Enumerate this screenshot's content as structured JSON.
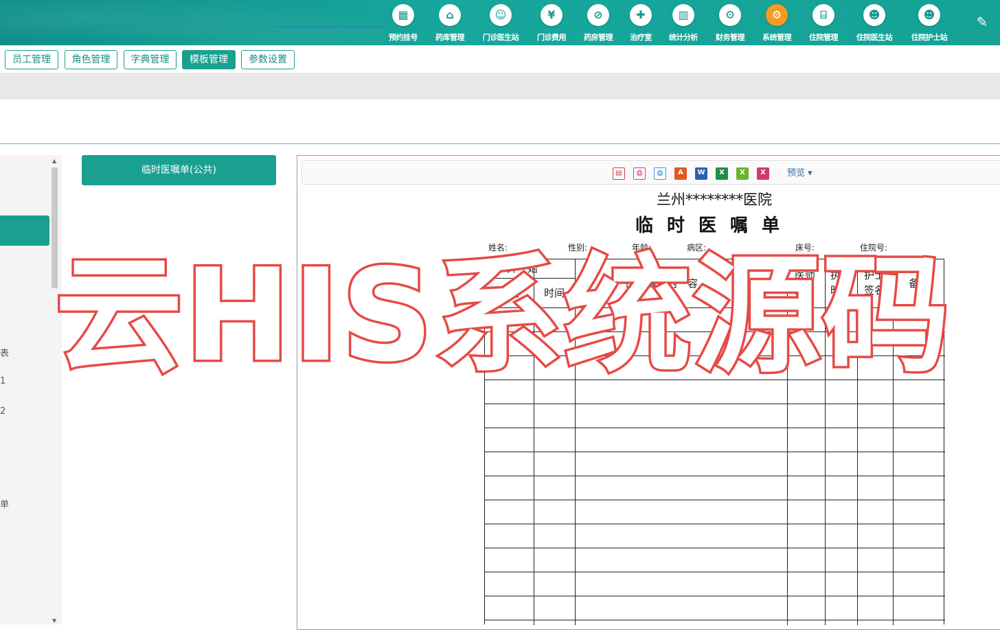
{
  "nav": {
    "items": [
      {
        "label": "预约挂号",
        "icon": "registration-icon"
      },
      {
        "label": "药库管理",
        "icon": "pharmacy-store-icon"
      },
      {
        "label": "门诊医生站",
        "icon": "doctor-icon"
      },
      {
        "label": "门诊费用",
        "icon": "yen-icon"
      },
      {
        "label": "药房管理",
        "icon": "pill-icon"
      },
      {
        "label": "治疗室",
        "icon": "treatment-icon"
      },
      {
        "label": "统计分析",
        "icon": "chart-icon"
      },
      {
        "label": "财务管理",
        "icon": "finance-gear-icon"
      },
      {
        "label": "系统管理",
        "icon": "system-gear-icon"
      },
      {
        "label": "住院管理",
        "icon": "bed-icon"
      },
      {
        "label": "住院医生站",
        "icon": "inpatient-doctor-icon"
      },
      {
        "label": "住院护士站",
        "icon": "nurse-icon"
      }
    ],
    "active_label": "系统管理",
    "edit_icon": "pencil-icon"
  },
  "subtabs": [
    {
      "label": "员工管理"
    },
    {
      "label": "角色管理"
    },
    {
      "label": "字典管理"
    },
    {
      "label": "模板管理"
    },
    {
      "label": "参数设置"
    }
  ],
  "active_subtab": "模板管理",
  "tree_fragments": [
    "表",
    "1",
    "2",
    "单"
  ],
  "template_button": "临时医嘱单(公共)",
  "toolbar": {
    "icons": [
      "page-setup-icon",
      "print-icon",
      "print-preview-icon",
      "pdf-icon",
      "word-icon",
      "excel-icon",
      "excel-alt-icon",
      "excel-xls-icon"
    ],
    "preview_label": "预览 ▾"
  },
  "doc": {
    "hospital": "兰州********医院",
    "title": "临时医嘱单",
    "fields": [
      "姓名:",
      "性别:",
      "年龄:",
      "病区:",
      "床号:",
      "住院号:"
    ],
    "headers": {
      "start": "开　始",
      "date": "日期",
      "time": "时间",
      "content": "医　嘱　内　容",
      "doctor_sig": "医师签名",
      "exec_time": "执行时间",
      "nurse_sig": "护士签名",
      "remark": "备注"
    }
  },
  "watermark": "云HIS系统源码",
  "colors": {
    "brand": "#1aa090",
    "active_nav": "#f59a23",
    "watermark_stroke": "#e64a46"
  }
}
